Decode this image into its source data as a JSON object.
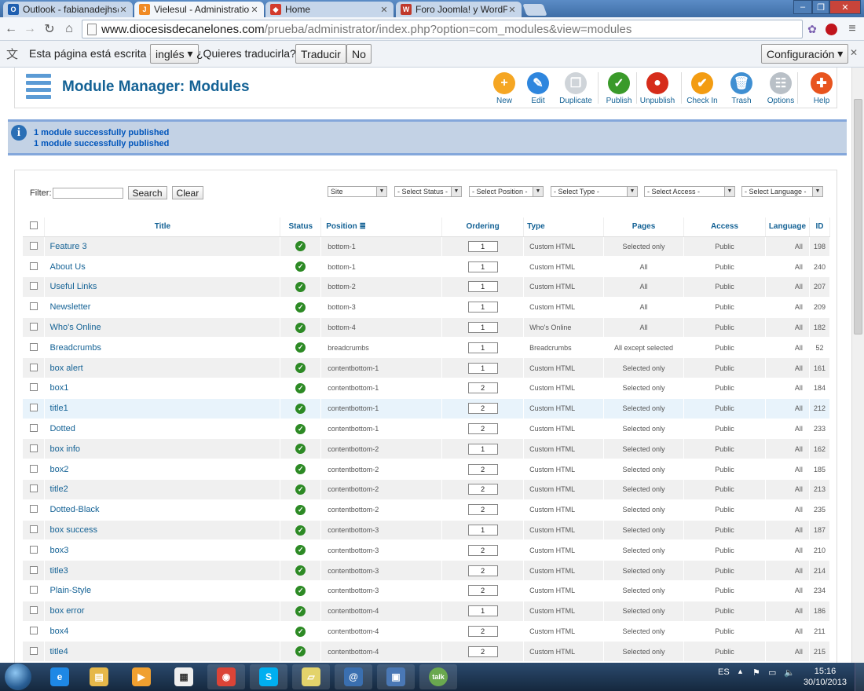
{
  "browser": {
    "tabs": [
      {
        "label": "Outlook - fabianadejhs@",
        "color": "#1f5fb0",
        "glyph": "O"
      },
      {
        "label": "Vielesul - Administration",
        "color": "#f08a24",
        "glyph": "J",
        "active": true
      },
      {
        "label": "Home",
        "color": "#d33b2c",
        "glyph": "◆"
      },
      {
        "label": "Foro Joomla! y WordPress",
        "color": "#c0392b",
        "glyph": "W"
      }
    ],
    "url_host": "www.diocesisdecanelones.com",
    "url_path": "/prueba/administrator/index.php?option=com_modules&view=modules"
  },
  "translate_bar": {
    "prefix": "Esta página está escrita en",
    "language": "inglés",
    "question": "¿Quieres traducirla?",
    "translate_btn": "Traducir",
    "no_btn": "No",
    "settings_btn": "Configuración"
  },
  "header": {
    "title": "Module Manager: Modules",
    "toolbar": [
      {
        "id": "new",
        "label": "New",
        "color": "#f5a623",
        "glyph": "+"
      },
      {
        "id": "edit",
        "label": "Edit",
        "color": "#2e86de",
        "glyph": "✎"
      },
      {
        "id": "duplicate",
        "label": "Duplicate",
        "color": "#cfd4d9",
        "glyph": "❐"
      },
      {
        "id": "publish",
        "label": "Publish",
        "color": "#3a9a2a",
        "glyph": "✓"
      },
      {
        "id": "unpublish",
        "label": "Unpublish",
        "color": "#d62c1a",
        "glyph": "●"
      },
      {
        "id": "checkin",
        "label": "Check In",
        "color": "#f39c12",
        "glyph": "✔"
      },
      {
        "id": "trash",
        "label": "Trash",
        "color": "#3f8fd2",
        "glyph": "🗑"
      },
      {
        "id": "options",
        "label": "Options",
        "color": "#b9c0c7",
        "glyph": "☷"
      },
      {
        "id": "help",
        "label": "Help",
        "color": "#e8541e",
        "glyph": "✚"
      }
    ]
  },
  "messages": [
    "1 module successfully published",
    "1 module successfully published"
  ],
  "filters": {
    "label": "Filter:",
    "search_btn": "Search",
    "clear_btn": "Clear",
    "selects": [
      "Site",
      "- Select Status -",
      "- Select Position -",
      "- Select Type -",
      "- Select Access -",
      "- Select Language -"
    ]
  },
  "columns": {
    "title": "Title",
    "status": "Status",
    "position": "Position",
    "ordering": "Ordering",
    "type": "Type",
    "pages": "Pages",
    "access": "Access",
    "language": "Language",
    "id": "ID"
  },
  "rows": [
    {
      "title": "Feature 3",
      "position": "bottom-1",
      "ordering": "1",
      "type": "Custom HTML",
      "pages": "Selected only",
      "access": "Public",
      "language": "All",
      "id": "198"
    },
    {
      "title": "About Us",
      "position": "bottom-1",
      "ordering": "1",
      "type": "Custom HTML",
      "pages": "All",
      "access": "Public",
      "language": "All",
      "id": "240"
    },
    {
      "title": "Useful Links",
      "position": "bottom-2",
      "ordering": "1",
      "type": "Custom HTML",
      "pages": "All",
      "access": "Public",
      "language": "All",
      "id": "207"
    },
    {
      "title": "Newsletter",
      "position": "bottom-3",
      "ordering": "1",
      "type": "Custom HTML",
      "pages": "All",
      "access": "Public",
      "language": "All",
      "id": "209"
    },
    {
      "title": "Who's Online",
      "position": "bottom-4",
      "ordering": "1",
      "type": "Who's Online",
      "pages": "All",
      "access": "Public",
      "language": "All",
      "id": "182"
    },
    {
      "title": "Breadcrumbs",
      "position": "breadcrumbs",
      "ordering": "1",
      "type": "Breadcrumbs",
      "pages": "All except selected",
      "access": "Public",
      "language": "All",
      "id": "52"
    },
    {
      "title": "box alert",
      "position": "contentbottom-1",
      "ordering": "1",
      "type": "Custom HTML",
      "pages": "Selected only",
      "access": "Public",
      "language": "All",
      "id": "161"
    },
    {
      "title": "box1",
      "position": "contentbottom-1",
      "ordering": "2",
      "type": "Custom HTML",
      "pages": "Selected only",
      "access": "Public",
      "language": "All",
      "id": "184"
    },
    {
      "title": "title1",
      "position": "contentbottom-1",
      "ordering": "2",
      "type": "Custom HTML",
      "pages": "Selected only",
      "access": "Public",
      "language": "All",
      "id": "212",
      "highlight": true
    },
    {
      "title": "Dotted",
      "position": "contentbottom-1",
      "ordering": "2",
      "type": "Custom HTML",
      "pages": "Selected only",
      "access": "Public",
      "language": "All",
      "id": "233"
    },
    {
      "title": "box info",
      "position": "contentbottom-2",
      "ordering": "1",
      "type": "Custom HTML",
      "pages": "Selected only",
      "access": "Public",
      "language": "All",
      "id": "162"
    },
    {
      "title": "box2",
      "position": "contentbottom-2",
      "ordering": "2",
      "type": "Custom HTML",
      "pages": "Selected only",
      "access": "Public",
      "language": "All",
      "id": "185"
    },
    {
      "title": "title2",
      "position": "contentbottom-2",
      "ordering": "2",
      "type": "Custom HTML",
      "pages": "Selected only",
      "access": "Public",
      "language": "All",
      "id": "213"
    },
    {
      "title": "Dotted-Black",
      "position": "contentbottom-2",
      "ordering": "2",
      "type": "Custom HTML",
      "pages": "Selected only",
      "access": "Public",
      "language": "All",
      "id": "235"
    },
    {
      "title": "box success",
      "position": "contentbottom-3",
      "ordering": "1",
      "type": "Custom HTML",
      "pages": "Selected only",
      "access": "Public",
      "language": "All",
      "id": "187"
    },
    {
      "title": "box3",
      "position": "contentbottom-3",
      "ordering": "2",
      "type": "Custom HTML",
      "pages": "Selected only",
      "access": "Public",
      "language": "All",
      "id": "210"
    },
    {
      "title": "title3",
      "position": "contentbottom-3",
      "ordering": "2",
      "type": "Custom HTML",
      "pages": "Selected only",
      "access": "Public",
      "language": "All",
      "id": "214"
    },
    {
      "title": "Plain-Style",
      "position": "contentbottom-3",
      "ordering": "2",
      "type": "Custom HTML",
      "pages": "Selected only",
      "access": "Public",
      "language": "All",
      "id": "234"
    },
    {
      "title": "box error",
      "position": "contentbottom-4",
      "ordering": "1",
      "type": "Custom HTML",
      "pages": "Selected only",
      "access": "Public",
      "language": "All",
      "id": "186"
    },
    {
      "title": "box4",
      "position": "contentbottom-4",
      "ordering": "2",
      "type": "Custom HTML",
      "pages": "Selected only",
      "access": "Public",
      "language": "All",
      "id": "211"
    },
    {
      "title": "title4",
      "position": "contentbottom-4",
      "ordering": "2",
      "type": "Custom HTML",
      "pages": "Selected only",
      "access": "Public",
      "language": "All",
      "id": "215"
    }
  ],
  "taskbar": {
    "apps": [
      {
        "name": "ie",
        "color": "#1e88e5",
        "glyph": "e"
      },
      {
        "name": "explorer",
        "color": "#e6b84a",
        "glyph": "▤"
      },
      {
        "name": "media-player",
        "color": "#f0a030",
        "glyph": "▶"
      },
      {
        "name": "calculator",
        "color": "#eeeeee",
        "glyph": "▦"
      },
      {
        "name": "chrome",
        "color": "#db4437",
        "glyph": "◉"
      },
      {
        "name": "skype",
        "color": "#00aff0",
        "glyph": "S"
      },
      {
        "name": "sticky-notes",
        "color": "#e3d36b",
        "glyph": "▱"
      },
      {
        "name": "outlook",
        "color": "#3a6fb0",
        "glyph": "@"
      },
      {
        "name": "network",
        "color": "#4a78b5",
        "glyph": "▣"
      },
      {
        "name": "google-talk",
        "color": "#6aa84f",
        "glyph": "talk"
      }
    ],
    "lang": "ES",
    "time": "15:16",
    "date": "30/10/2013"
  }
}
